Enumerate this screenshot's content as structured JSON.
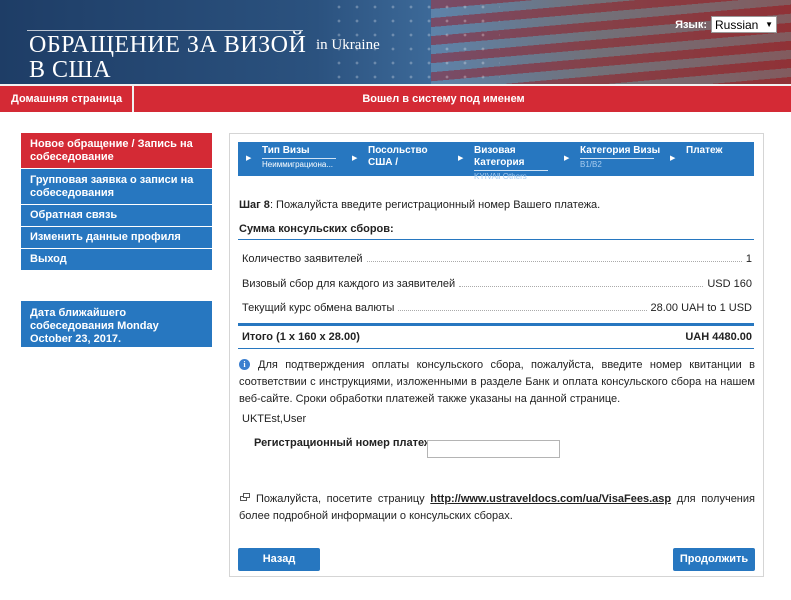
{
  "header": {
    "app_title": "Обращение за визой в США",
    "country": "in Ukraine",
    "language_label": "Язык:",
    "language_value": "Russian"
  },
  "navbar": {
    "home": "Домашняя страница",
    "logged_in": "Вошел в систему под именем"
  },
  "sidebar": {
    "items": [
      {
        "label": "Новое обращение / Запись на собеседование"
      },
      {
        "label": "Групповая заявка о записи на собеседования"
      },
      {
        "label": "Обратная связь"
      },
      {
        "label": "Изменить данные профиля"
      },
      {
        "label": "Выход"
      }
    ],
    "next_interview": "Дата ближайшего собеседования Monday October 23, 2017."
  },
  "steps": [
    {
      "label": "Тип Визы",
      "value": "Неиммиграциона..."
    },
    {
      "label": "Посольство США /",
      "value": ""
    },
    {
      "label": "Визовая Категория",
      "value": "KYIVAll Others"
    },
    {
      "label": "Категория Визы",
      "value": "B1/B2"
    },
    {
      "label": "Платеж",
      "value": ""
    }
  ],
  "main": {
    "step_prefix": "Шаг 8",
    "step_text": ": Пожалуйста введите регистрационный номер Вашего платежа.",
    "summary_title": "Сумма консульских сборов:",
    "fees": [
      {
        "label": "Количество заявителей",
        "value": "1"
      },
      {
        "label": "Визовый сбор для каждого из заявителей",
        "value": "USD 160"
      },
      {
        "label": "Текущий курс обмена валюты",
        "value": "28.00 UAH to 1 USD"
      }
    ],
    "total_label": "Итого (1 x 160 x 28.00)",
    "total_value": "UAH 4480.00",
    "info_text": "Для подтверждения оплаты консульского сбора, пожалуйста, введите номер квитанции в соответствии с инструкциями, изложенными в разделе Банк и оплата консульского сбора на нашем веб-сайте. Сроки обработки платежей также указаны на данной странице.",
    "user_name": "UKTEst,User",
    "reg_label": "Регистрационный номер платежа:",
    "reg_value": "",
    "link_prefix": "Пожалуйста, посетите страницу",
    "link_url": "http://www.ustraveldocs.com/ua/VisaFees.asp",
    "link_suffix": "для получения более подробной информации о консульских сборах.",
    "back_label": "Назад",
    "continue_label": "Продолжить"
  },
  "colors": {
    "primary_blue": "#2777c0",
    "brand_red": "#d42a35"
  }
}
